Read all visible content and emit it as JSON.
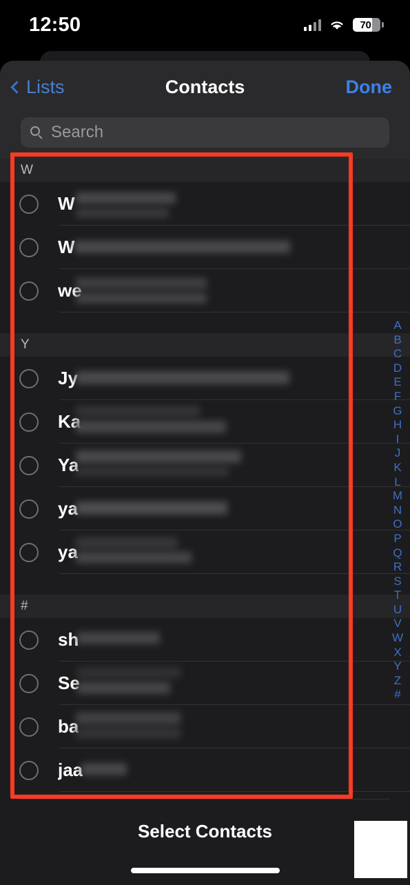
{
  "status_bar": {
    "time": "12:50",
    "cellular_icon": "cellular-bars-icon",
    "wifi_icon": "wifi-icon",
    "battery_level": "70",
    "battery_percent": 70
  },
  "nav": {
    "back_label": "Lists",
    "back_icon": "chevron-left-icon",
    "title": "Contacts",
    "done_label": "Done"
  },
  "search": {
    "placeholder": "Search",
    "icon": "search-icon",
    "value": ""
  },
  "footer": {
    "title": "Select Contacts"
  },
  "index_letters": [
    "A",
    "B",
    "C",
    "D",
    "E",
    "F",
    "G",
    "H",
    "I",
    "J",
    "K",
    "L",
    "M",
    "N",
    "O",
    "P",
    "Q",
    "R",
    "S",
    "T",
    "U",
    "V",
    "W",
    "X",
    "Y",
    "Z",
    "#"
  ],
  "sections": [
    {
      "header": "W",
      "rows": [
        {
          "name_prefix": "W",
          "selected": false,
          "lines": 2
        },
        {
          "name_prefix": "W",
          "selected": false,
          "lines": 1
        },
        {
          "name_prefix": "we",
          "selected": false,
          "lines": 2
        }
      ]
    },
    {
      "header": "Y",
      "rows": [
        {
          "name_prefix": "Jy",
          "selected": false,
          "lines": 1
        },
        {
          "name_prefix": "Ka",
          "selected": false,
          "lines": 2
        },
        {
          "name_prefix": "Ya",
          "selected": false,
          "lines": 2
        },
        {
          "name_prefix": "ya",
          "selected": false,
          "lines": 1
        },
        {
          "name_prefix": "ya",
          "selected": false,
          "lines": 2
        }
      ]
    },
    {
      "header": "#",
      "rows": [
        {
          "name_prefix": "sh",
          "selected": false,
          "lines": 1
        },
        {
          "name_prefix": "Se",
          "selected": false,
          "lines": 2
        },
        {
          "name_prefix": "ba",
          "selected": false,
          "lines": 2
        },
        {
          "name_prefix": "jaa",
          "selected": false,
          "lines": 1
        }
      ]
    }
  ],
  "annotation": {
    "color": "#fa3a22",
    "shape": "rectangle-highlight"
  },
  "colors": {
    "accent_blue": "#0a84ff",
    "sheet_bg": "#1c1c1e",
    "nav_bg": "#2a2a2c",
    "section_header_bg": "#262628",
    "annotation_red": "#fa3a22"
  }
}
